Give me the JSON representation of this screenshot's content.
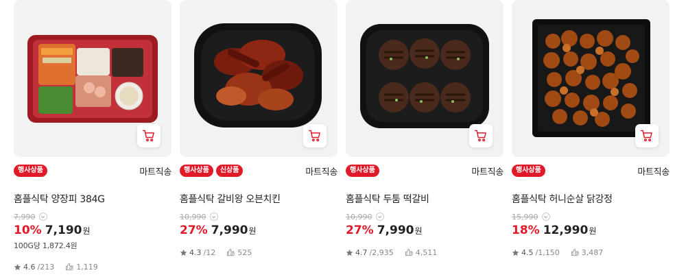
{
  "products": [
    {
      "badges": [
        "행사상품"
      ],
      "delivery": "마트직송",
      "name": "홈플식탁 양장피 384G",
      "original_price": "7,990",
      "discount": "10%",
      "price": "7,190",
      "currency": "원",
      "unit_price": "100G당 1,872.4원",
      "rating": "4.6",
      "reviews": "/213",
      "likes": "1,119",
      "image": "yangjangpi-tray"
    },
    {
      "badges": [
        "행사상품",
        "신상품"
      ],
      "delivery": "마트직송",
      "name": "홈플식탁 갈비왕 오븐치킨",
      "original_price": "10,990",
      "discount": "27%",
      "price": "7,990",
      "currency": "원",
      "unit_price": "",
      "rating": "4.3",
      "reviews": "/12",
      "likes": "525",
      "image": "oven-chicken-tray"
    },
    {
      "badges": [
        "행사상품"
      ],
      "delivery": "마트직송",
      "name": "홈플식탁 두툼 떡갈비",
      "original_price": "10,990",
      "discount": "27%",
      "price": "7,990",
      "currency": "원",
      "unit_price": "",
      "rating": "4.7",
      "reviews": "/2,935",
      "likes": "4,511",
      "image": "tteokgalbi-tray"
    },
    {
      "badges": [
        "행사상품"
      ],
      "delivery": "마트직송",
      "name": "홈플식탁 허니순살 닭강정",
      "original_price": "15,990",
      "discount": "18%",
      "price": "12,990",
      "currency": "원",
      "unit_price": "",
      "rating": "4.5",
      "reviews": "/1,150",
      "likes": "3,487",
      "image": "dakgangjeong-tray"
    }
  ],
  "colors": {
    "accent": "#e11a2a",
    "thumb_bg": "#f2f2f2"
  },
  "icons": {
    "cart": "cart-icon",
    "chevron": "chevron-down-icon",
    "star": "star-icon",
    "likes": "review-count-icon"
  }
}
